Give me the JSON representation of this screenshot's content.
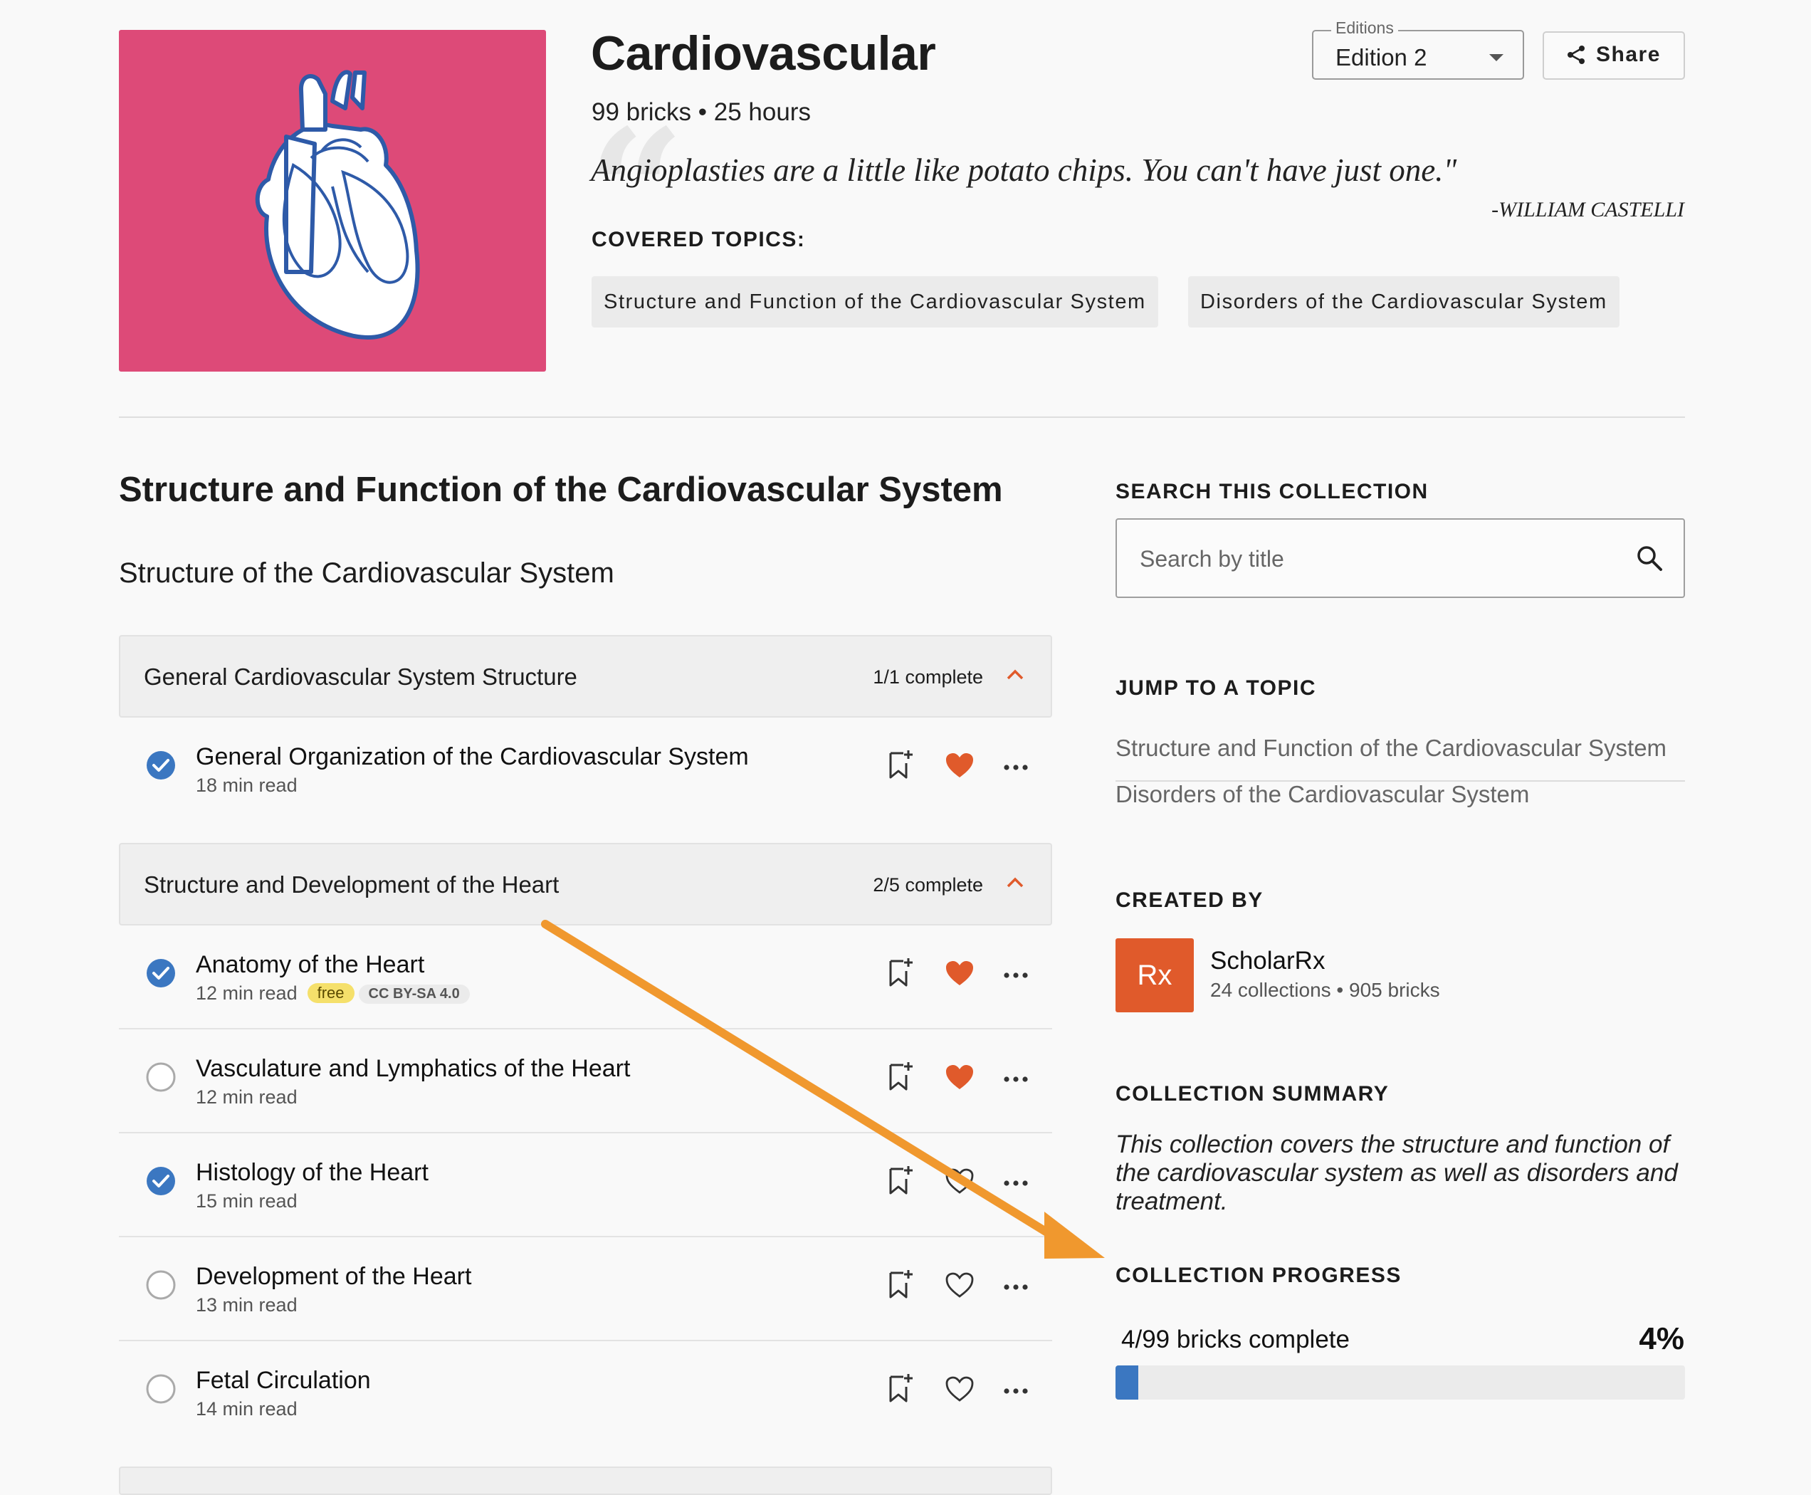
{
  "collection": {
    "title": "Cardiovascular",
    "meta": "99 bricks • 25 hours",
    "quote": "Angioplasties are a little like potato chips. You can't have just one.\"",
    "quote_author": "-WILLIAM CASTELLI",
    "covered_topics_label": "COVERED TOPICS:",
    "covered_topics": [
      "Structure and Function of the Cardiovascular System",
      "Disorders of the Cardiovascular System"
    ],
    "cover_color": "#dd4a78",
    "cover_icon": "heart-anatomy-icon"
  },
  "editions": {
    "label": "Editions",
    "value": "Edition 2"
  },
  "share": {
    "label": "Share",
    "icon": "share-icon"
  },
  "section": {
    "title": "Structure and Function of the Cardiovascular System",
    "subsection": "Structure of the Cardiovascular System",
    "groups": [
      {
        "title": "General Cardiovascular System Structure",
        "progress": "1/1 complete",
        "items": [
          {
            "title": "General Organization of the Cardiovascular System",
            "read": "18 min read",
            "completed": true,
            "liked": true
          }
        ]
      },
      {
        "title": "Structure and Development of the Heart",
        "progress": "2/5 complete",
        "items": [
          {
            "title": "Anatomy of the Heart",
            "read": "12 min read",
            "badge_free": "free",
            "badge_license": "CC BY-SA 4.0",
            "completed": true,
            "liked": true
          },
          {
            "title": "Vasculature and Lymphatics of the Heart",
            "read": "12 min read",
            "completed": false,
            "liked": true
          },
          {
            "title": "Histology of the Heart",
            "read": "15 min read",
            "completed": true,
            "liked": false
          },
          {
            "title": "Development of the Heart",
            "read": "13 min read",
            "completed": false,
            "liked": false
          },
          {
            "title": "Fetal Circulation",
            "read": "14 min read",
            "completed": false,
            "liked": false
          }
        ]
      }
    ]
  },
  "sidebar": {
    "search_label": "SEARCH THIS COLLECTION",
    "search_placeholder": "Search by title",
    "jump_label": "JUMP TO A TOPIC",
    "jump_links": [
      "Structure and Function of the Cardiovascular System",
      "Disorders of the Cardiovascular System"
    ],
    "created_by_label": "CREATED BY",
    "creator": {
      "avatar_text": "Rx",
      "name": "ScholarRx",
      "meta": "24 collections • 905 bricks"
    },
    "summary_label": "COLLECTION SUMMARY",
    "summary_text": "This collection covers the structure and function of the cardiovascular system as well as disorders and treatment.",
    "progress_label": "COLLECTION PROGRESS",
    "progress_count": "4/99 bricks complete",
    "progress_percent": "4%",
    "progress_fraction": 0.04
  },
  "colors": {
    "accent": "#e05a2b",
    "check": "#3b77c1",
    "heart_liked": "#e05a2b",
    "annotation_arrow": "#f0982e"
  }
}
